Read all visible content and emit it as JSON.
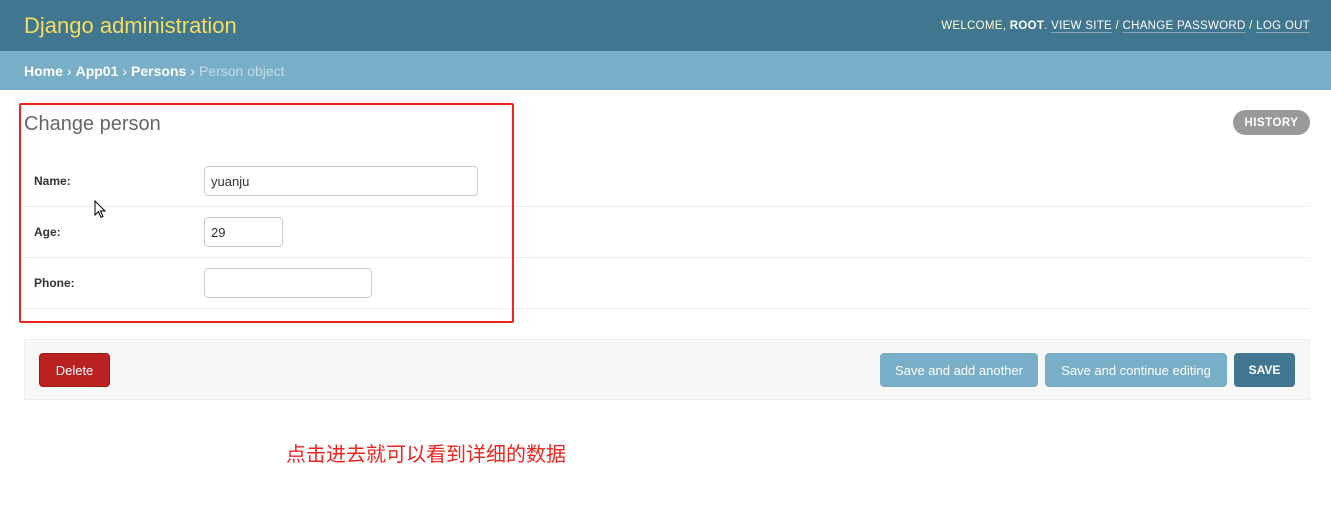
{
  "header": {
    "branding": "Django administration",
    "welcome": "WELCOME, ",
    "user": "ROOT",
    "view_site": "VIEW SITE",
    "change_password": "CHANGE PASSWORD",
    "log_out": "LOG OUT"
  },
  "breadcrumbs": [
    "Home",
    "App01",
    "Persons",
    "Person object"
  ],
  "title": "Change person",
  "history_label": "HISTORY",
  "fields": [
    {
      "label": "Name:",
      "value": "yuanju"
    },
    {
      "label": "Age:",
      "value": "29"
    },
    {
      "label": "Phone:",
      "value": ""
    }
  ],
  "buttons": {
    "delete": "Delete",
    "save_add_another": "Save and add another",
    "save_continue": "Save and continue editing",
    "save": "SAVE"
  },
  "annotation": "点击进去就可以看到详细的数据",
  "colors": {
    "header": "#417690",
    "breadcrumbs": "#79aec8",
    "branding": "#f5dd5d",
    "delete": "#ba2121",
    "annotation": "#f0241f"
  }
}
